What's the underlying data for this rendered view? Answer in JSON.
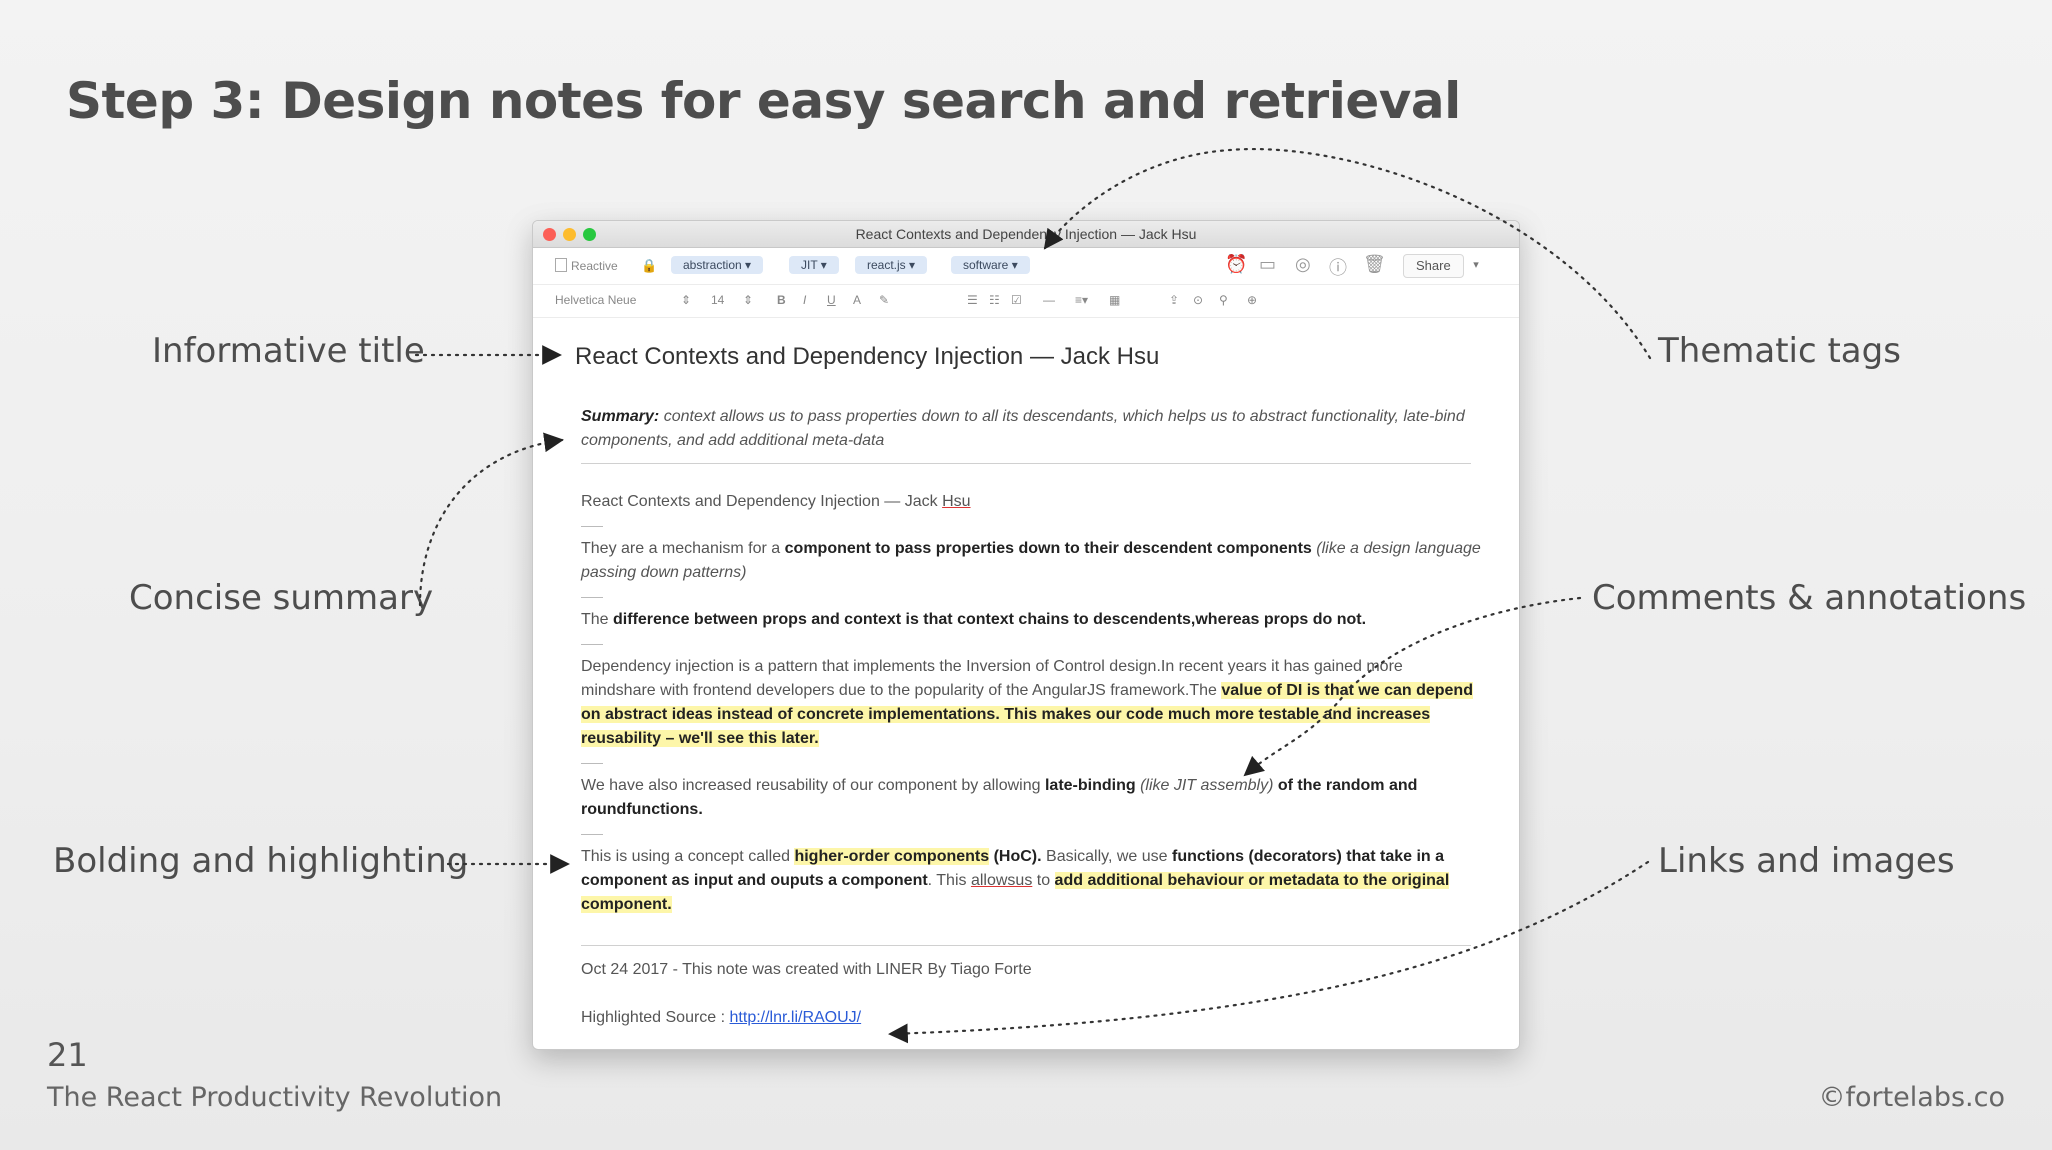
{
  "slide": {
    "title": "Step 3: Design notes for easy search and retrieval",
    "page_number": "21",
    "subtitle": "The React Productivity Revolution",
    "copyright": "©fortelabs.co"
  },
  "labels": {
    "informative_title": "Informative title",
    "concise_summary": "Concise summary",
    "bolding_highlighting": "Bolding and highlighting",
    "thematic_tags": "Thematic tags",
    "comments_annotations": "Comments & annotations",
    "links_images": "Links and images"
  },
  "window": {
    "title": "React Contexts and Dependency Injection — Jack Hsu",
    "notebook": "Reactive",
    "tags": [
      "abstraction",
      "JIT",
      "react.js",
      "software"
    ],
    "share_label": "Share",
    "font_name": "Helvetica Neue",
    "font_size": "14"
  },
  "note": {
    "title": "React Contexts and Dependency Injection — Jack Hsu",
    "summary_label": "Summary:",
    "summary_text": " context allows us to pass properties down to all its descendants, which helps us to abstract functionality, late-bind components, and add additional meta-data",
    "heading_prefix": "React Contexts and Dependency Injection — Jack ",
    "heading_name": "Hsu",
    "p1_a": "They are a mechanism for a ",
    "p1_b": "component to pass properties down to their descendent components",
    "p1_c": " (like a design language passing down patterns)",
    "p2_a": "The ",
    "p2_b": "difference between props and context is that context chains to descendents,whereas props do not.",
    "p3_a": "Dependency injection is a pattern that implements the Inversion of Control design.In recent years it has gained more mindshare with frontend developers due to the popularity of the AngularJS framework.The ",
    "p3_b": "value of DI is that we can depend on abstract ideas instead of concrete implementations. This makes our code much more testable and increases reusability – we'll see this later.",
    "p4_a": "We have also increased reusability of our component by allowing ",
    "p4_b": "late-binding",
    "p4_c": " (like JIT assembly)",
    "p4_d": " of the random and roundfunctions.",
    "p5_a": "This is using a concept called ",
    "p5_b": "higher-order components",
    "p5_c": " (HoC).",
    "p5_d": " Basically, we use ",
    "p5_e": "functions (decorators) that take in a component as input and ouputs a component",
    "p5_f": ". This ",
    "p5_g": "allowsus",
    "p5_h": " to ",
    "p5_i": "add additional behaviour or metadata to the original component.",
    "footer_line": "Oct 24 2017 - This note was created with LINER By Tiago Forte",
    "source_label": "Highlighted Source : ",
    "source_link": "http://lnr.li/RAOUJ/"
  }
}
